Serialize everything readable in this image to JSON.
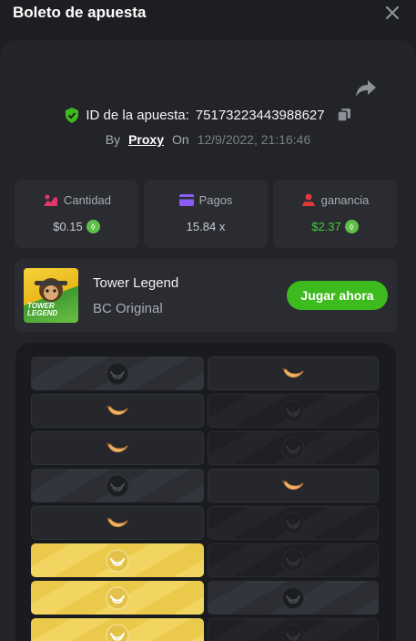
{
  "header": {
    "title": "Boleto de apuesta"
  },
  "bet": {
    "id_label": "ID de la apuesta:",
    "id_value": "75173223443988627",
    "by_label": "By",
    "user": "Proxy",
    "on_label": "On",
    "date": "12/9/2022, 21:16:46"
  },
  "stats": {
    "amount": {
      "label": "Cantidad",
      "value": "$0.15"
    },
    "payout": {
      "label": "Pagos",
      "value": "15.84 x"
    },
    "profit": {
      "label": "ganancia",
      "value": "$2.37"
    }
  },
  "game": {
    "name": "Tower Legend",
    "provider": "BC Original",
    "thumb_text": "TOWER LEGEND",
    "play_label": "Jugar ahora"
  },
  "board": {
    "rows": [
      [
        "bomb",
        "banana"
      ],
      [
        "banana",
        "dim"
      ],
      [
        "banana",
        "dim"
      ],
      [
        "bomb",
        "banana"
      ],
      [
        "banana",
        "dim"
      ],
      [
        "gold",
        "dim"
      ],
      [
        "gold",
        "bomb"
      ],
      [
        "gold",
        "dim"
      ]
    ]
  },
  "colors": {
    "accent_green": "#3dba1e",
    "profit_green": "#3fcf3a",
    "gold": "#ebc94a"
  }
}
